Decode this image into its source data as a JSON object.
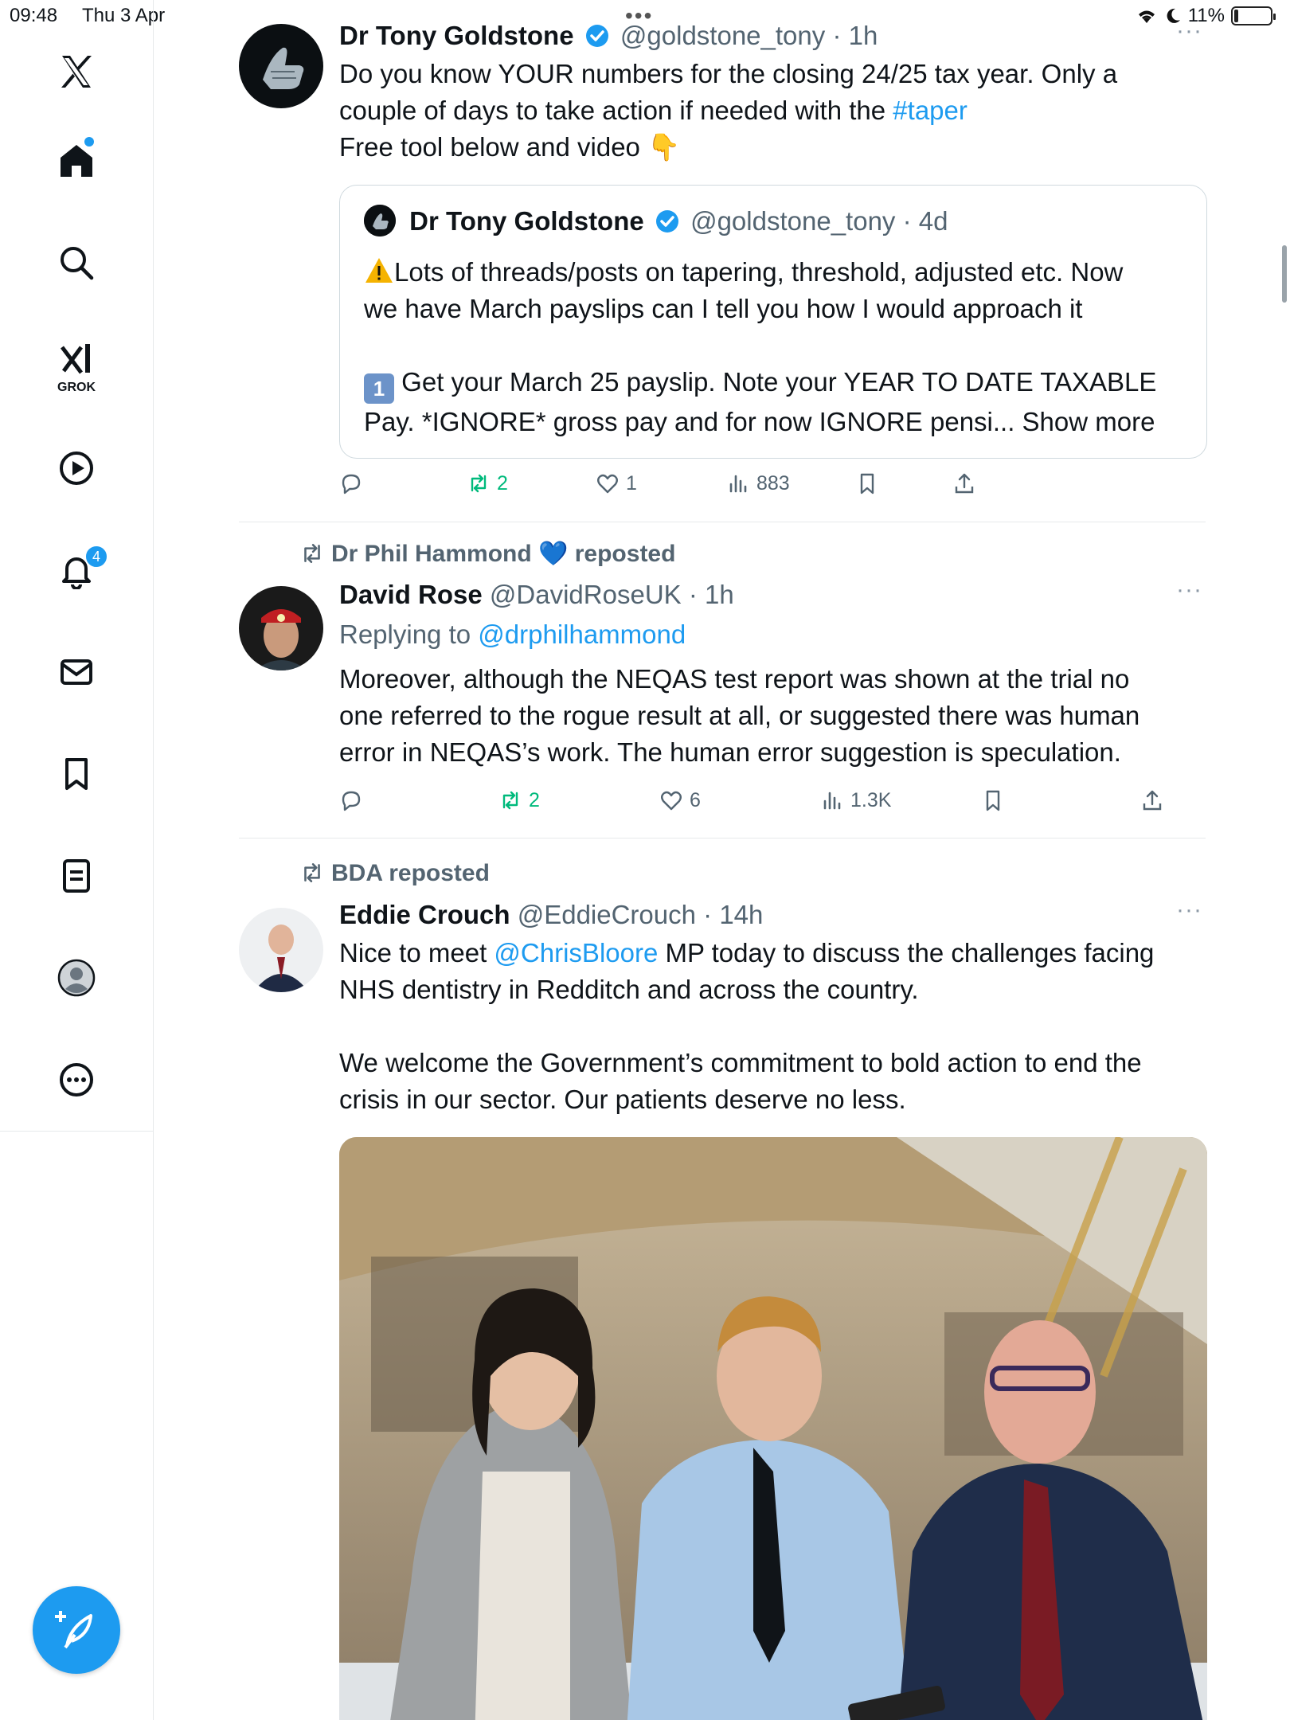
{
  "status": {
    "time": "09:48",
    "date": "Thu 3 Apr",
    "battery_text": "11%",
    "battery_level": 0.11
  },
  "sidebar": {
    "grok_label": "GROK",
    "notifications_count": "4"
  },
  "posts": [
    {
      "name": "Dr Tony Goldstone",
      "handle": "@goldstone_tony",
      "time": "· 1h",
      "more": "···",
      "text_line1": "Do you know YOUR numbers for the closing 24/25 tax year. Only a",
      "text_line2_pre": "couple of days to take action if needed with the ",
      "hashtag": "#taper",
      "text_line3": "Free tool below and video",
      "text_line3_emoji": "👇",
      "quote": {
        "name": "Dr Tony Goldstone",
        "handle": "@goldstone_tony",
        "time": "· 4d",
        "line1": "Lots of threads/posts on tapering, threshold, adjusted etc. Now",
        "line2": "we have March payslips can I tell you how I would approach it",
        "line3": "Get your March 25 payslip. Note your YEAR TO DATE TAXABLE",
        "line4": "Pay. *IGNORE* gross pay and for now IGNORE pensi... Show more",
        "keycap": "1"
      },
      "stats": {
        "reposts": "2",
        "likes": "1",
        "views": "883"
      }
    },
    {
      "repost_by": "Dr Phil Hammond",
      "repost_suffix": "reposted",
      "repost_emoji": "💙",
      "name": "David Rose",
      "handle": "@DavidRoseUK",
      "time": "· 1h",
      "more": "···",
      "replying_prefix": "Replying to ",
      "replying_to": "@drphilhammond",
      "text_line1": "Moreover, although the NEQAS test report was shown at the trial no",
      "text_line2": "one referred to the rogue result at all, or suggested there was human",
      "text_line3": "error in NEQAS’s work. The human error suggestion is speculation.",
      "stats": {
        "reposts": "2",
        "likes": "6",
        "views": "1.3K"
      }
    },
    {
      "repost_by": "BDA reposted",
      "name": "Eddie Crouch",
      "handle": "@EddieCrouch",
      "time": "· 14h",
      "more": "···",
      "text_line1_pre": "Nice to meet ",
      "mention": "@ChrisBloore",
      "text_line1_post": " MP today to discuss the challenges facing",
      "text_line2": "NHS dentistry in Redditch and across the country.",
      "text_line3": "We welcome the Government’s commitment to bold action to end the",
      "text_line4": "crisis in our sector. Our patients deserve no less."
    }
  ],
  "colors": {
    "accent": "#1d9bf0",
    "repost_green": "#00ba7c",
    "muted": "#536471"
  }
}
